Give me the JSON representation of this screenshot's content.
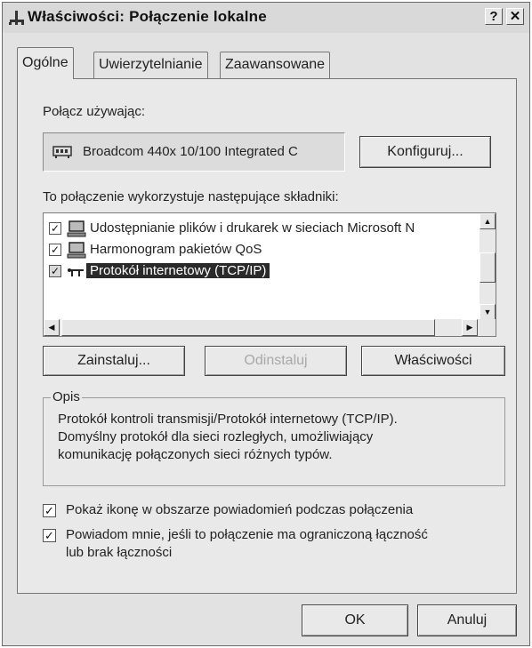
{
  "window": {
    "title": "Właściwości: Połączenie lokalne",
    "help_btn": "?",
    "close_btn": "✕"
  },
  "tabs": [
    {
      "label": "Ogólne",
      "active": true
    },
    {
      "label": "Uwierzytelnianie",
      "active": false
    },
    {
      "label": "Zaawansowane",
      "active": false
    }
  ],
  "connect_using": {
    "label": "Połącz używając:",
    "adapter": "Broadcom 440x 10/100 Integrated C",
    "configure_label": "Konfiguruj..."
  },
  "components": {
    "label": "To połączenie wykorzystuje następujące składniki:",
    "items": [
      {
        "text": "Udostępnianie plików i drukarek w sieciach Microsoft N",
        "checked": true,
        "icon": "network-computer-icon",
        "selected": false
      },
      {
        "text": "Harmonogram pakietów QoS",
        "checked": true,
        "icon": "network-computer-icon",
        "selected": false
      },
      {
        "text": "Protokół internetowy (TCP/IP)",
        "checked": true,
        "icon": "protocol-icon",
        "selected": true
      }
    ]
  },
  "actions": {
    "install": "Zainstaluj...",
    "uninstall": "Odinstaluj",
    "properties": "Właściwości"
  },
  "description": {
    "title": "Opis",
    "line1": "Protokół kontroli transmisji/Protokół internetowy (TCP/IP).",
    "line2": "Domyślny protokół dla sieci rozległych, umożliwiający",
    "line3": "komunikację połączonych sieci różnych typów."
  },
  "options": {
    "show_icon": {
      "label": "Pokaż ikonę w obszarze powiadomień podczas połączenia",
      "checked": true
    },
    "notify_line1": "Powiadom mnie, jeśli to połączenie ma ograniczoną łączność",
    "notify_line2": "lub brak łączności",
    "notify_checked": true
  },
  "footer": {
    "ok": "OK",
    "cancel": "Anuluj"
  }
}
